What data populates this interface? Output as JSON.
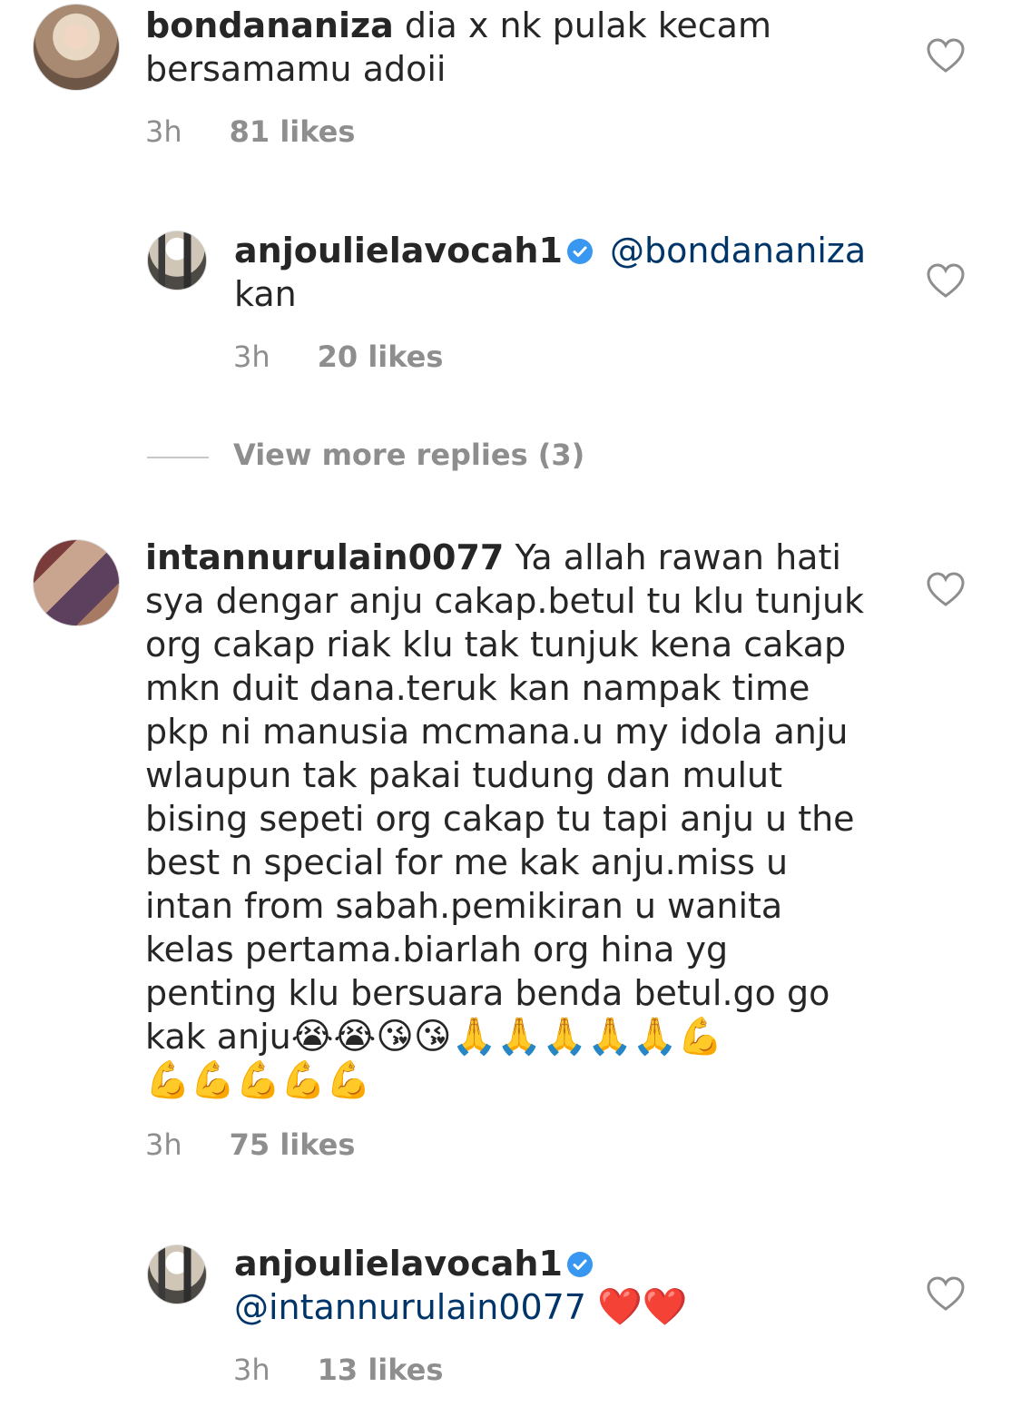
{
  "comments": [
    {
      "username": "bondananiza",
      "lines": [
        "dia x nk pulak kecam",
        "bersamamu adoii"
      ],
      "time": "3h",
      "likes": "81 likes"
    },
    {
      "username": "anjoulielavocah1",
      "verified": true,
      "mention": "@bondananiza",
      "lines": [
        "kan"
      ],
      "time": "3h",
      "likes": "20 likes"
    },
    {
      "view_more": "View more replies (3)"
    },
    {
      "username": "intannurulain0077",
      "lines": [
        "Ya allah rawan hati",
        "sya dengar anju cakap.betul tu klu tunjuk",
        "org cakap riak klu tak tunjuk kena cakap",
        "mkn duit dana.teruk kan nampak time",
        "pkp ni manusia mcmana.u my idola anju",
        "wlaupun tak pakai tudung dan mulut",
        "bising sepeti org cakap tu tapi anju u the",
        "best n special for me kak anju.miss u",
        "intan from sabah.pemikiran u wanita",
        "kelas pertama.biarlah org hina yg",
        "penting klu bersuara benda betul.go go",
        "kak anju"
      ],
      "emoji_line1": "😭😭😘😘🙏🙏🙏🙏🙏💪",
      "emoji_line2": "💪💪💪💪💪",
      "time": "3h",
      "likes": "75 likes"
    },
    {
      "username": "anjoulielavocah1",
      "verified": true,
      "mention": "@intannurulain0077",
      "emoji": "❤️❤️",
      "time": "3h",
      "likes": "13 likes"
    }
  ],
  "icons": {
    "like": "heart-outline-icon",
    "verified": "verified-badge-icon"
  },
  "colors": {
    "text": "#262626",
    "meta": "#8e8e8e",
    "mention": "#003569",
    "verified": "#3897f0"
  }
}
